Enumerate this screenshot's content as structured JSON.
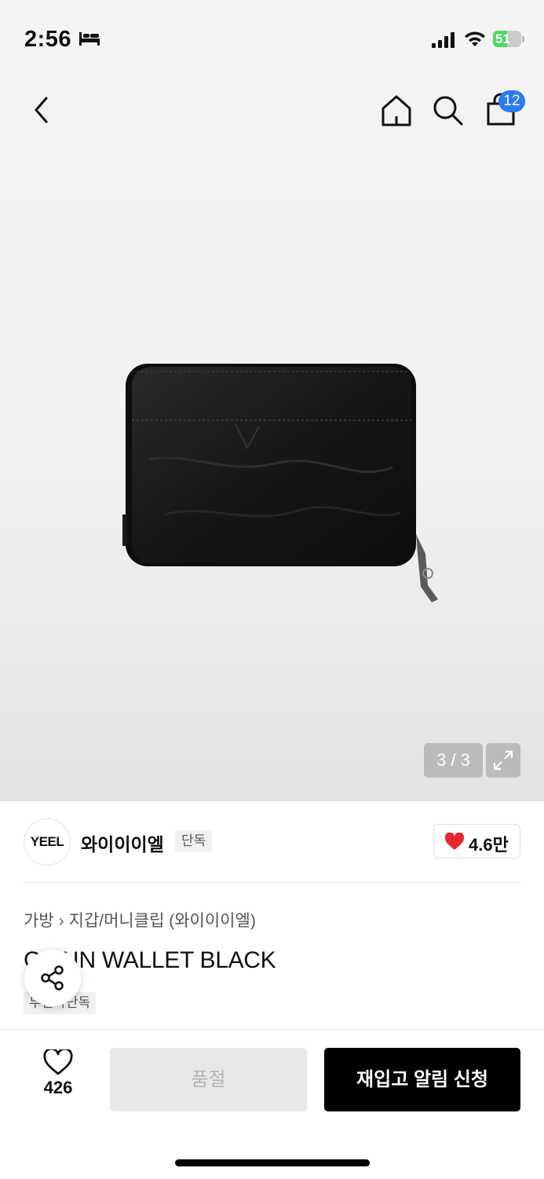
{
  "status_bar": {
    "time": "2:56",
    "battery_level": "51",
    "battery_fraction": 0.51
  },
  "header": {
    "cart_count": "12"
  },
  "gallery": {
    "pager": "3 / 3"
  },
  "brand": {
    "logo_text": "YEEL",
    "name": "와이이이엘",
    "tag": "단독",
    "like_count": "4.6만"
  },
  "breadcrumb": {
    "category": "가방",
    "separator": "›",
    "subcategory": "지갑/머니클립 (와이이이엘)"
  },
  "product": {
    "title": "CHAIN WALLET BLACK",
    "exclusive_tag": "무신사단독"
  },
  "bottom_bar": {
    "wish_count": "426",
    "soldout_label": "품절",
    "restock_label": "재입고 알림 신청"
  },
  "colors": {
    "accent_blue": "#2b7bf0",
    "heart_red": "#e8262e",
    "cta_black": "#000000"
  }
}
